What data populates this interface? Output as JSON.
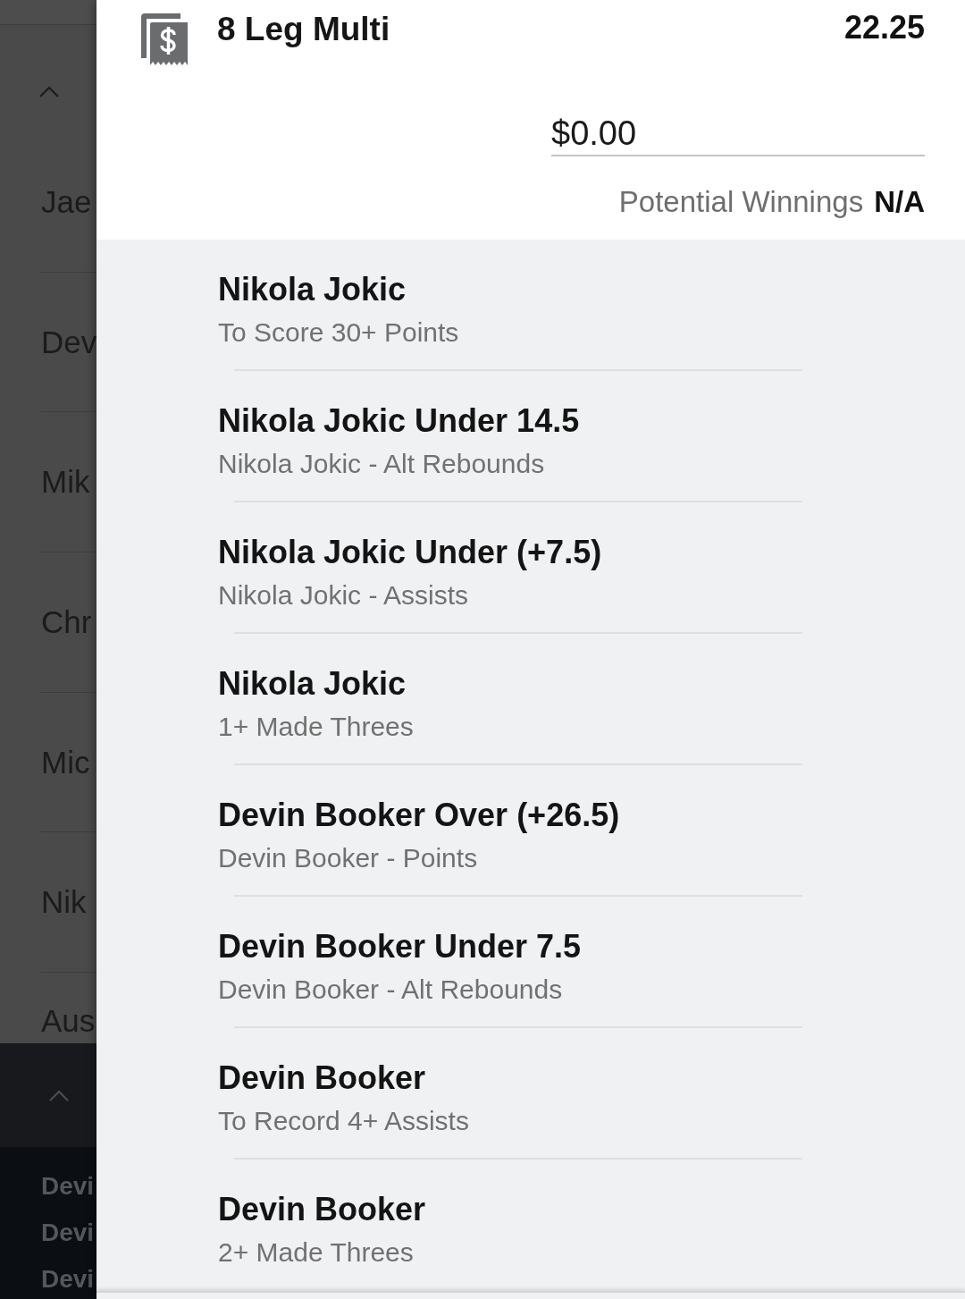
{
  "background_list": {
    "items": [
      "Jae",
      "Dev",
      "Mik",
      "Chr",
      "Mic",
      "Nik",
      "Aus"
    ]
  },
  "background_sublist": {
    "items": [
      "Devi",
      "Devi",
      "Devi"
    ]
  },
  "bet_slip": {
    "title": "8 Leg Multi",
    "odds": "22.25",
    "stake": {
      "value": "$0.00"
    },
    "potential_winnings": {
      "label": "Potential Winnings",
      "value": "N/A"
    },
    "legs": [
      {
        "selection": "Nikola Jokic",
        "market": "To Score 30+ Points"
      },
      {
        "selection": "Nikola Jokic Under 14.5",
        "market": "Nikola Jokic - Alt Rebounds"
      },
      {
        "selection": "Nikola Jokic Under (+7.5)",
        "market": "Nikola Jokic - Assists"
      },
      {
        "selection": "Nikola Jokic",
        "market": "1+ Made Threes"
      },
      {
        "selection": "Devin Booker Over (+26.5)",
        "market": "Devin Booker - Points"
      },
      {
        "selection": "Devin Booker Under 7.5",
        "market": "Devin Booker - Alt Rebounds"
      },
      {
        "selection": "Devin Booker",
        "market": "To Record 4+ Assists"
      },
      {
        "selection": "Devin Booker",
        "market": "2+ Made Threes"
      }
    ]
  }
}
